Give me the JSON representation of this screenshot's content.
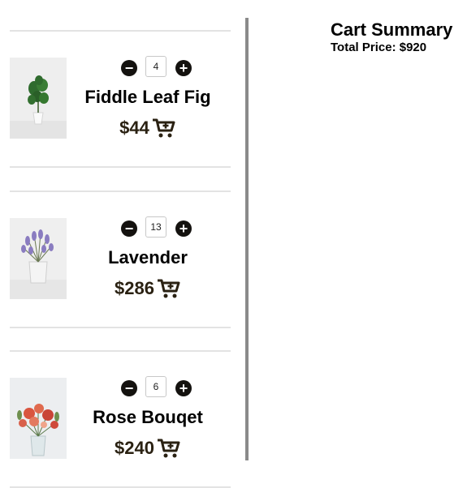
{
  "cart": {
    "items": [
      {
        "name": "Fiddle Leaf Fig",
        "quantity": "4",
        "price": "$44"
      },
      {
        "name": "Lavender",
        "quantity": "13",
        "price": "$286"
      },
      {
        "name": "Rose Bouqet",
        "quantity": "6",
        "price": "$240"
      }
    ]
  },
  "summary": {
    "title": "Cart Summary",
    "total_label": "Total Price: $920"
  },
  "icons": {
    "decrease": "minus-circle-icon",
    "increase": "plus-circle-icon",
    "cart": "cart-plus-icon"
  },
  "colors": {
    "button_fill": "#14120f",
    "price_text": "#2a2112",
    "divider": "#8a8a8a"
  }
}
